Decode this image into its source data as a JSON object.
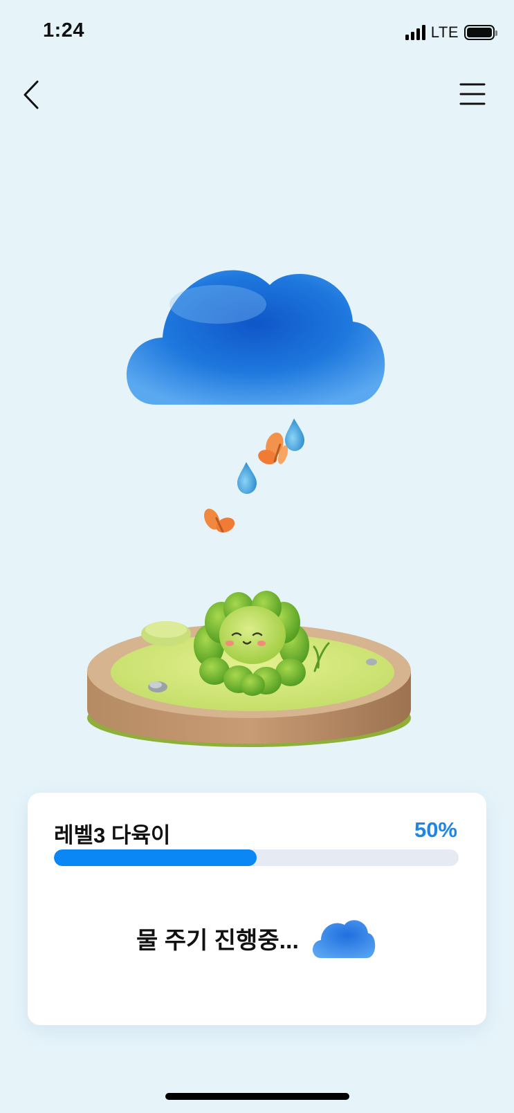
{
  "status_bar": {
    "time": "1:24",
    "network": "LTE",
    "icons": [
      "signal-icon",
      "battery-icon"
    ]
  },
  "header": {
    "back_icon": "chevron-left-icon",
    "menu_icon": "hamburger-menu-icon"
  },
  "scene": {
    "elements": [
      "rain-cloud",
      "water-drop",
      "water-drop",
      "butterfly",
      "butterfly",
      "succulent-plant",
      "grass-island"
    ]
  },
  "progress_card": {
    "title": "레벨3 다육이",
    "percent_label": "50%",
    "progress": 0.5,
    "status_text": "물 주기 진행중...",
    "status_icon": "cloud-icon"
  },
  "colors": {
    "background": "#e6f4fa",
    "accent": "#1f86e6",
    "progress_fill": "#0b86f5",
    "progress_track": "#e6ebf3"
  }
}
